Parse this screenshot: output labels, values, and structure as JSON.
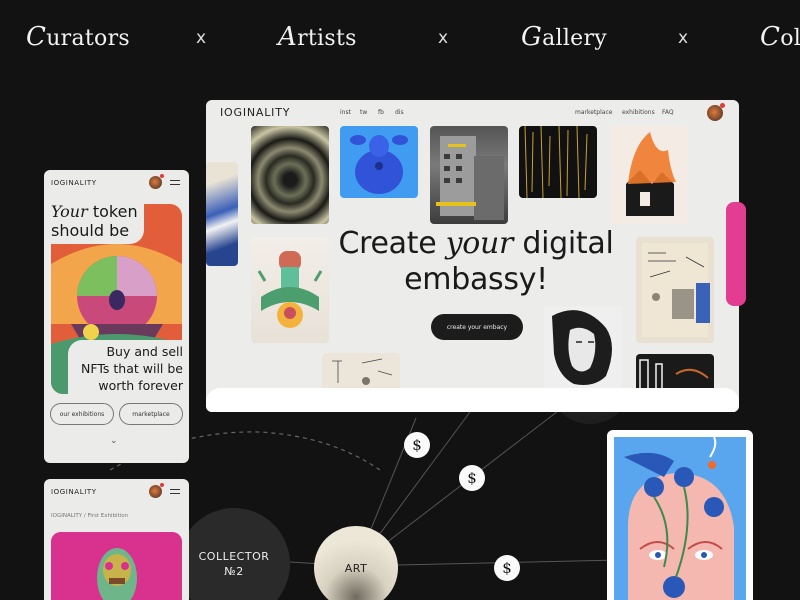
{
  "marquee": {
    "words": [
      {
        "initial": "C",
        "rest": "urators"
      },
      {
        "initial": "A",
        "rest": "rtists"
      },
      {
        "initial": "G",
        "rest": "allery"
      },
      {
        "initial": "C",
        "rest": "oll"
      }
    ],
    "separator": "x"
  },
  "desktop": {
    "logo": "IOGINALITY",
    "nav_left": [
      "inst",
      "tw",
      "fb",
      "dis"
    ],
    "nav_right": [
      "marketplace",
      "exhibitions",
      "FAQ"
    ],
    "hero_line1_pre": "Create",
    "hero_line1_italic": "your",
    "hero_line1_post": "digital",
    "hero_line2": "embassy!",
    "cta_label": "create your embacy"
  },
  "mobile_home": {
    "logo": "IOGINALITY",
    "title_italic": "Your",
    "title_rest": "token",
    "title_line2": "should be",
    "buy_line1": "Buy and sell",
    "buy_line2": "NFTs that will be",
    "buy_line3": "worth forever",
    "btn_exhibitions": "our exhibitions",
    "btn_marketplace": "marketplace",
    "chevron": "⌄"
  },
  "mobile_exhibition": {
    "logo": "IOGINALITY",
    "breadcrumb": "IOGINALITY  /  First Exhibition"
  },
  "network": {
    "collector_line1": "COLLECTOR",
    "collector_line2": "№2",
    "art_label": "ART",
    "dollar": "$"
  },
  "colors": {
    "background": "#121212",
    "card": "#ececea",
    "accent_pink": "#e23d90",
    "notification": "#e23a3a"
  }
}
